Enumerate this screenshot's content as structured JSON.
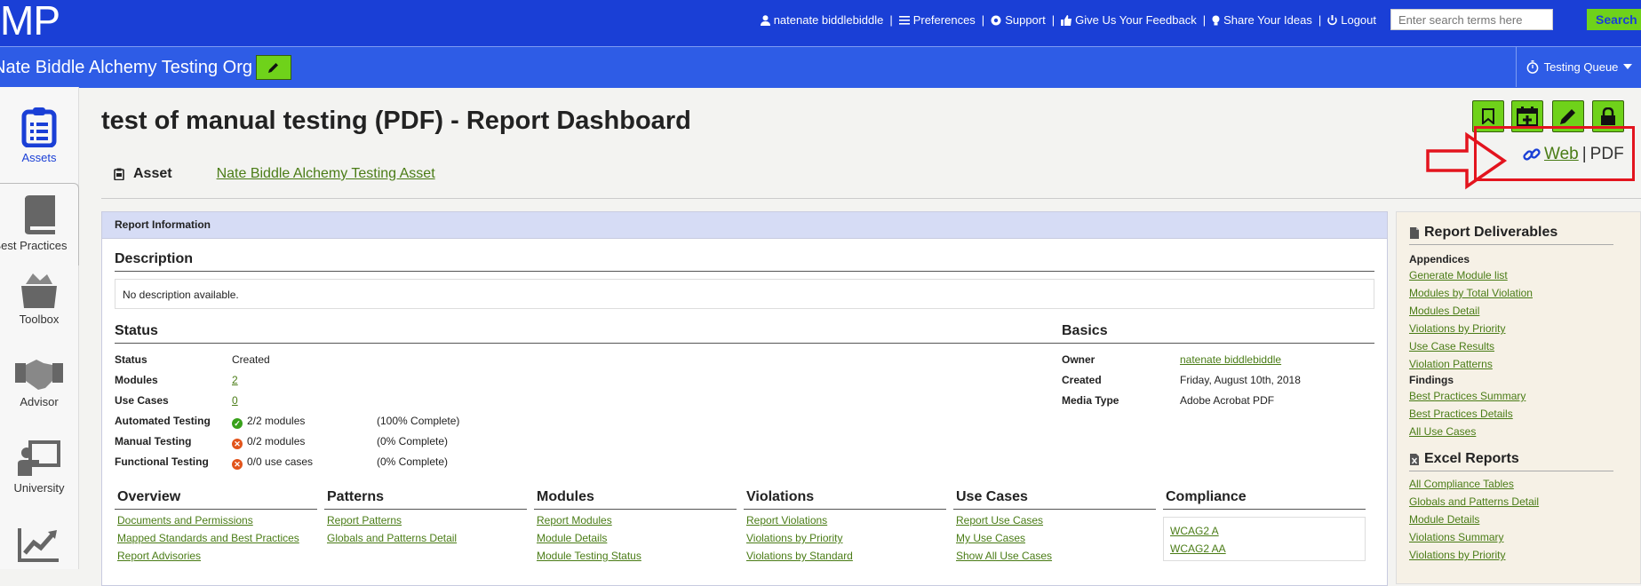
{
  "app": {
    "logo": "MP"
  },
  "topnav": {
    "user": "natenate biddlebiddle",
    "preferences": "Preferences",
    "support": "Support",
    "feedback": "Give Us Your Feedback",
    "ideas": "Share Your Ideas",
    "logout": "Logout",
    "separator": "|"
  },
  "search": {
    "placeholder": "Enter search terms here",
    "button": "Search"
  },
  "org": {
    "title": "Nate Biddle Alchemy Testing Org",
    "queue": "Testing Queue"
  },
  "sidebar": {
    "items": [
      {
        "label": "Assets",
        "icon": "clipboard-icon"
      },
      {
        "label": "Best Practices",
        "icon": "book-icon"
      },
      {
        "label": "Toolbox",
        "icon": "toolbox-icon"
      },
      {
        "label": "Advisor",
        "icon": "handshake-icon"
      },
      {
        "label": "University",
        "icon": "teacher-icon"
      },
      {
        "label": "",
        "icon": "chart-line-icon"
      }
    ]
  },
  "page": {
    "title": "test of manual testing (PDF) - Report Dashboard",
    "asset_label": "Asset",
    "asset_link": "Nate Biddle Alchemy Testing Asset",
    "format_web": "Web",
    "format_sep": "|",
    "format_pdf": "PDF"
  },
  "report": {
    "header": "Report Information",
    "description_title": "Description",
    "description_text": "No description available.",
    "status_title": "Status",
    "status_rows": [
      {
        "k": "Status",
        "v": "Created"
      },
      {
        "k": "Modules",
        "v": "2"
      },
      {
        "k": "Use Cases",
        "v": "0"
      },
      {
        "k": "Automated Testing",
        "v": "2/2 modules",
        "pct": "(100% Complete)"
      },
      {
        "k": "Manual Testing",
        "v": "0/2 modules",
        "pct": "(0% Complete)"
      },
      {
        "k": "Functional Testing",
        "v": "0/0 use cases",
        "pct": "(0% Complete)"
      }
    ],
    "basics_title": "Basics",
    "basics_rows": [
      {
        "k": "Owner",
        "v": "natenate biddlebiddle"
      },
      {
        "k": "Created",
        "v": "Friday, August 10th, 2018"
      },
      {
        "k": "Media Type",
        "v": "Adobe Acrobat PDF"
      }
    ],
    "columns": [
      {
        "title": "Overview",
        "links": [
          "Documents and Permissions",
          "Mapped Standards and Best Practices",
          "Report Advisories"
        ]
      },
      {
        "title": "Patterns",
        "links": [
          "Report Patterns",
          "Globals and Patterns Detail"
        ]
      },
      {
        "title": "Modules",
        "links": [
          "Report Modules",
          "Module Details",
          "Module Testing Status"
        ]
      },
      {
        "title": "Violations",
        "links": [
          "Report Violations",
          "Violations by Priority",
          "Violations by Standard"
        ]
      },
      {
        "title": "Use Cases",
        "links": [
          "Report Use Cases",
          "My Use Cases",
          "Show All Use Cases"
        ]
      },
      {
        "title": "Compliance",
        "links": [
          "WCAG2 A",
          "WCAG2 AA"
        ]
      }
    ]
  },
  "deliverables": {
    "title": "Report Deliverables",
    "appendices_label": "Appendices",
    "appendices": [
      "Generate Module list",
      "Modules by Total Violation",
      "Modules Detail",
      "Violations by Priority",
      "Use Case Results",
      "Violation Patterns"
    ],
    "findings_label": "Findings",
    "findings": [
      "Best Practices Summary",
      "Best Practices Details",
      "All Use Cases"
    ],
    "excel_title": "Excel Reports",
    "excel": [
      "All Compliance Tables",
      "Globals and Patterns Detail",
      "Module Details",
      "Violations Summary",
      "Violations by Priority"
    ]
  },
  "colors": {
    "topbar": "#1a3fd6",
    "orgbar": "#2e5ce6",
    "accent_green": "#6fd21a",
    "link": "#4a7c16",
    "annotation_red": "#e3141e"
  }
}
